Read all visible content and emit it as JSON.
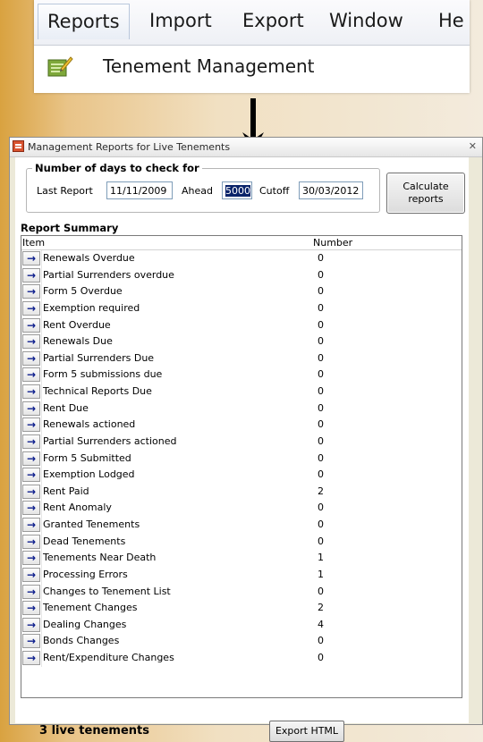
{
  "menu": {
    "items": [
      "Reports",
      "Import",
      "Export",
      "Window",
      "He"
    ],
    "dropdown_item": "Tenement Management"
  },
  "dialog": {
    "title": "Management Reports for Live Tenements",
    "close_glyph": "✕",
    "group_title": "Number of days to check for",
    "last_report_label": "Last Report",
    "last_report_value": "11/11/2009",
    "ahead_label": "Ahead",
    "ahead_value": "5000",
    "cutoff_label": "Cutoff",
    "cutoff_value": "30/03/2012",
    "calculate_button": "Calculate\nreports",
    "summary_title": "Report Summary",
    "columns": [
      "Item",
      "Number"
    ],
    "rows": [
      {
        "name": "Renewals Overdue",
        "number": "0"
      },
      {
        "name": "Partial Surrenders overdue",
        "number": "0"
      },
      {
        "name": "Form 5 Overdue",
        "number": "0"
      },
      {
        "name": "Exemption required",
        "number": "0"
      },
      {
        "name": "Rent Overdue",
        "number": "0"
      },
      {
        "name": "Renewals Due",
        "number": "0"
      },
      {
        "name": "Partial Surrenders Due",
        "number": "0"
      },
      {
        "name": "Form 5 submissions due",
        "number": "0"
      },
      {
        "name": "Technical Reports Due",
        "number": "0"
      },
      {
        "name": "Rent Due",
        "number": "0"
      },
      {
        "name": "Renewals actioned",
        "number": "0"
      },
      {
        "name": "Partial Surrenders actioned",
        "number": "0"
      },
      {
        "name": "Form 5 Submitted",
        "number": "0"
      },
      {
        "name": "Exemption Lodged",
        "number": "0"
      },
      {
        "name": "Rent Paid",
        "number": "2"
      },
      {
        "name": "Rent Anomaly",
        "number": "0"
      },
      {
        "name": "Granted Tenements",
        "number": "0"
      },
      {
        "name": "Dead Tenements",
        "number": "0"
      },
      {
        "name": "Tenements Near Death",
        "number": "1"
      },
      {
        "name": "Processing Errors",
        "number": "1"
      },
      {
        "name": "Changes to Tenement List",
        "number": "0"
      },
      {
        "name": "Tenement Changes",
        "number": "2"
      },
      {
        "name": "Dealing Changes",
        "number": "4"
      },
      {
        "name": "Bonds Changes",
        "number": "0"
      },
      {
        "name": "Rent/Expenditure Changes",
        "number": "0"
      }
    ],
    "footer_status": "3 live tenements",
    "export_button": "Export HTML"
  },
  "colors": {
    "background_left": "#d9a240",
    "arrow_blue": "#0b1c8c",
    "selection": "#0a246a"
  }
}
